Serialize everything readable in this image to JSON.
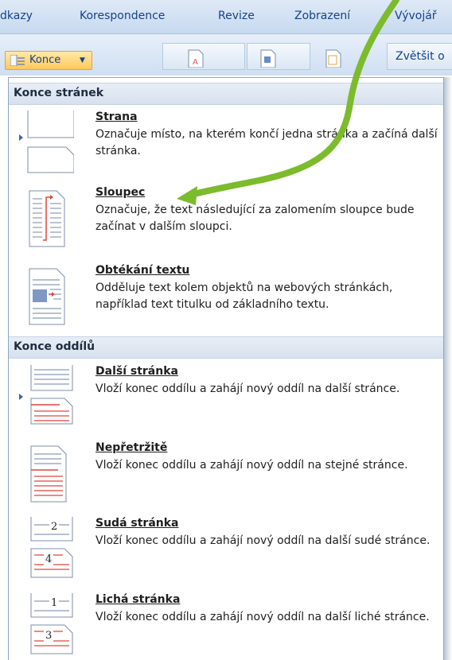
{
  "ribbon": {
    "tabs": [
      "dkazy",
      "Korespondence",
      "Revize",
      "Zobrazení",
      "Vývojář"
    ],
    "konce_button": "Konce",
    "zoom_button": "Zvětšit o"
  },
  "menu": {
    "sections": [
      {
        "header": "Konce stránek",
        "items": [
          {
            "title": "Strana",
            "description": "Označuje místo, na kterém končí jedna stránka a začíná další stránka.",
            "icon": "page-break-icon"
          },
          {
            "title": "Sloupec",
            "description": "Označuje, že text následující za zalomením sloupce bude začínat v dalším sloupci.",
            "icon": "column-break-icon"
          },
          {
            "title": "Obtékání textu",
            "description": "Odděluje text kolem objektů na webových stránkách, například text titulku od základního textu.",
            "icon": "text-wrapping-icon"
          }
        ]
      },
      {
        "header": "Konce oddílů",
        "items": [
          {
            "title": "Další stránka",
            "description": "Vloží konec oddílu a zahájí nový oddíl na další stránce.",
            "icon": "next-page-icon"
          },
          {
            "title": "Nepřetržitě",
            "description": "Vloží konec oddílu a zahájí nový oddíl na stejné stránce.",
            "icon": "continuous-icon"
          },
          {
            "title": "Sudá stránka",
            "description": "Vloží konec oddílu a zahájí nový oddíl na další sudé stránce.",
            "icon": "even-page-icon",
            "numbers": [
              "2",
              "4"
            ]
          },
          {
            "title": "Lichá stránka",
            "description": "Vloží konec oddílu a zahájí nový oddíl na další liché stránce.",
            "icon": "odd-page-icon",
            "numbers": [
              "1",
              "3"
            ]
          }
        ]
      }
    ]
  },
  "colors": {
    "accent_arrow": "#7cbb2c",
    "ribbon_text": "#15428b",
    "break_line": "#e0463a"
  }
}
